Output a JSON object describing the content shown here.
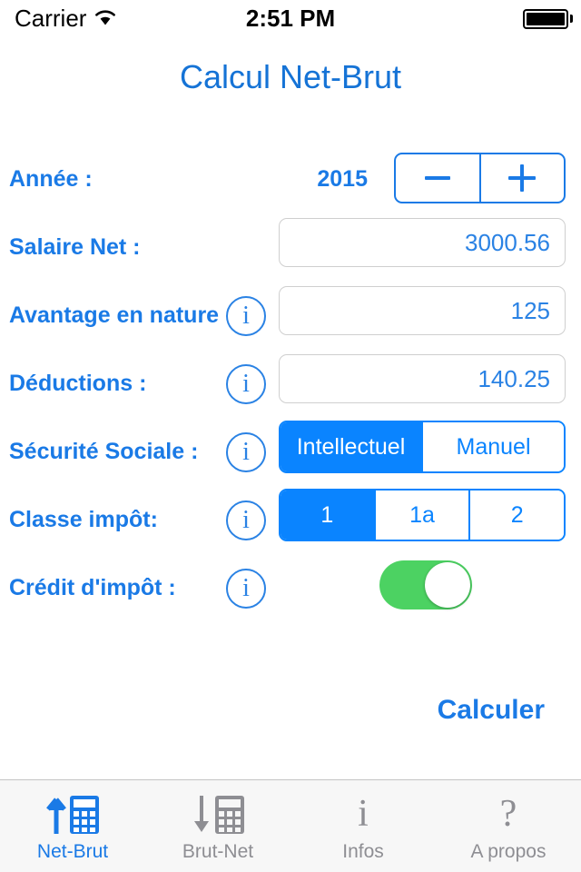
{
  "status_bar": {
    "carrier": "Carrier",
    "wifi_icon": "wifi-icon",
    "time": "2:51 PM",
    "battery_icon": "battery-full-icon"
  },
  "header": {
    "title": "Calcul Net-Brut"
  },
  "colors": {
    "accent_blue": "#1a7ae6",
    "segment_blue": "#0a84ff",
    "toggle_green": "#4cd262",
    "inactive_gray": "#8e8e93",
    "field_border": "#cfcfcf"
  },
  "form": {
    "rows": [
      {
        "label": "Année :",
        "type": "stepper",
        "value": "2015",
        "decrement_label": "−",
        "increment_label": "+"
      },
      {
        "label": "Salaire Net :",
        "type": "textfield",
        "value": "3000.56",
        "placeholder": ""
      },
      {
        "label": "Avantage en nature :",
        "type": "textfield",
        "info": "i",
        "value": "125",
        "placeholder": ""
      },
      {
        "label": "Déductions :",
        "type": "textfield",
        "info": "i",
        "value": "140.25",
        "placeholder": ""
      },
      {
        "label": "Sécurité Sociale :",
        "type": "segmented",
        "info": "i",
        "options": [
          "Intellectuel",
          "Manuel"
        ],
        "selected_index": 0
      },
      {
        "label": "Classe impôt:",
        "type": "segmented",
        "info": "i",
        "options": [
          "1",
          "1a",
          "2"
        ],
        "selected_index": 0
      },
      {
        "label": "Crédit d'impôt :",
        "type": "toggle",
        "info": "i",
        "on": true
      }
    ]
  },
  "actions": {
    "calculate_label": "Calculer"
  },
  "tabbar": {
    "tabs": [
      {
        "label": "Net-Brut",
        "icon": "arrow-up-calculator-icon",
        "active": true
      },
      {
        "label": "Brut-Net",
        "icon": "arrow-down-calculator-icon",
        "active": false
      },
      {
        "label": "Infos",
        "icon": "info-i-icon",
        "active": false
      },
      {
        "label": "A propos",
        "icon": "question-mark-icon",
        "active": false
      }
    ]
  }
}
